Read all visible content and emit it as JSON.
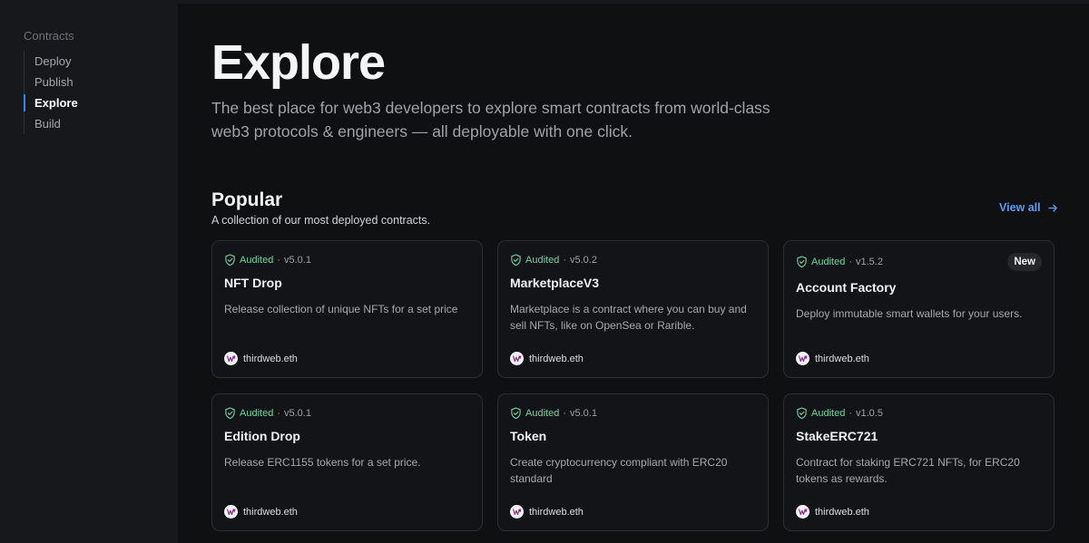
{
  "sidebar": {
    "heading": "Contracts",
    "items": [
      {
        "label": "Deploy"
      },
      {
        "label": "Publish"
      },
      {
        "label": "Explore",
        "active": true
      },
      {
        "label": "Build"
      }
    ]
  },
  "main": {
    "title": "Explore",
    "description": "The best place for web3 developers to explore smart contracts from world-class web3 protocols & engineers — all deployable with one click.",
    "section": {
      "title": "Popular",
      "subtitle": "A collection of our most deployed contracts.",
      "view_all": "View all"
    },
    "cards": [
      {
        "audited": "Audited",
        "version": "v5.0.1",
        "title": "NFT Drop",
        "description": "Release collection of unique NFTs for a set price",
        "author": "thirdweb.eth",
        "badge": ""
      },
      {
        "audited": "Audited",
        "version": "v5.0.2",
        "title": "MarketplaceV3",
        "description": "Marketplace is a contract where you can buy and sell NFTs, like on OpenSea or Rarible.",
        "author": "thirdweb.eth",
        "badge": ""
      },
      {
        "audited": "Audited",
        "version": "v1.5.2",
        "title": "Account Factory",
        "description": "Deploy immutable smart wallets for your users.",
        "author": "thirdweb.eth",
        "badge": "New"
      },
      {
        "audited": "Audited",
        "version": "v5.0.1",
        "title": "Edition Drop",
        "description": "Release ERC1155 tokens for a set price.",
        "author": "thirdweb.eth",
        "badge": ""
      },
      {
        "audited": "Audited",
        "version": "v5.0.1",
        "title": "Token",
        "description": "Create cryptocurrency compliant with ERC20 standard",
        "author": "thirdweb.eth",
        "badge": ""
      },
      {
        "audited": "Audited",
        "version": "v1.0.5",
        "title": "StakeERC721",
        "description": "Contract for staking ERC721 NFTs, for ERC20 tokens as rewards.",
        "author": "thirdweb.eth",
        "badge": ""
      }
    ]
  },
  "colors": {
    "accent": "#3b82f6",
    "link": "#5b9bf5",
    "audited": "#6fd4a1",
    "background": "#0f1012"
  },
  "icons": {
    "audited": "shield-check-icon",
    "view_all": "arrow-right-icon",
    "author": "thirdweb-logo-icon"
  }
}
